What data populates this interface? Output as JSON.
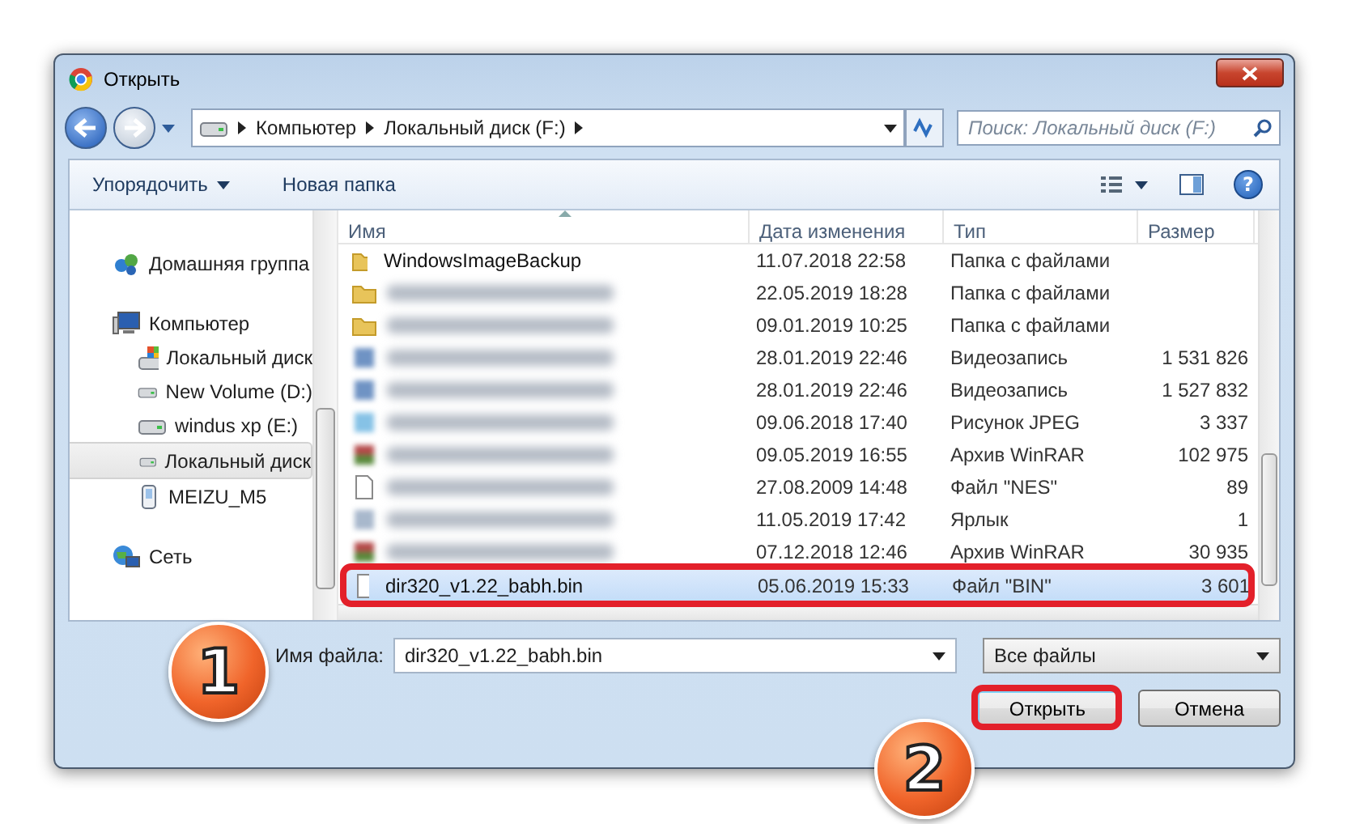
{
  "window": {
    "title": "Открыть"
  },
  "address": {
    "crumbs": [
      "Компьютер",
      "Локальный диск (F:)"
    ]
  },
  "search": {
    "placeholder": "Поиск: Локальный диск (F:)"
  },
  "toolbar": {
    "buttons": [
      "Упорядочить",
      "Новая папка"
    ],
    "help": "?"
  },
  "sidebar": {
    "items": [
      {
        "label": "Домашняя группа",
        "kind": "homegroup",
        "selected": false
      },
      {
        "label": "Компьютер",
        "kind": "computer",
        "selected": false,
        "children": [
          {
            "label": "Локальный диск",
            "kind": "system-drive",
            "selected": false
          },
          {
            "label": "New Volume (D:)",
            "kind": "drive",
            "selected": false
          },
          {
            "label": "windus xp (E:)",
            "kind": "drive",
            "selected": false
          },
          {
            "label": "Локальный диск",
            "kind": "drive",
            "selected": true
          },
          {
            "label": "MEIZU_M5",
            "kind": "phone",
            "selected": false
          }
        ]
      },
      {
        "label": "Сеть",
        "kind": "network",
        "selected": false
      }
    ]
  },
  "table": {
    "columns": [
      "Имя",
      "Дата изменения",
      "Тип",
      "Размер"
    ],
    "rows": [
      {
        "kind": "folder",
        "name": "WindowsImageBackup",
        "date": "11.07.2018 22:58",
        "type": "Папка с файлами",
        "selected": false,
        "highlighted": false
      },
      {
        "kind": "folder",
        "blurred": true,
        "date": "22.05.2019 18:28",
        "type": "Папка с файлами",
        "selected": false,
        "highlighted": false
      },
      {
        "kind": "folder",
        "blurred": true,
        "date": "09.01.2019 10:25",
        "type": "Папка с файлами",
        "selected": false,
        "highlighted": false
      },
      {
        "kind": "video",
        "blurred": true,
        "date": "28.01.2019 22:46",
        "type": "Видеозапись",
        "size": "1 531 826",
        "selected": false,
        "highlighted": false
      },
      {
        "kind": "video",
        "blurred": true,
        "date": "28.01.2019 22:46",
        "type": "Видеозапись",
        "size": "1 527 832",
        "selected": false,
        "highlighted": false
      },
      {
        "kind": "image",
        "blurred": true,
        "date": "09.06.2018 17:40",
        "type": "Рисунок JPEG",
        "size": "3 337",
        "selected": false,
        "highlighted": false
      },
      {
        "kind": "archive",
        "blurred": true,
        "date": "09.05.2019 16:55",
        "type": "Архив WinRAR",
        "size": "102 975",
        "selected": false,
        "highlighted": false
      },
      {
        "kind": "file",
        "blurred": true,
        "date": "27.08.2009 14:48",
        "type": "Файл \"NES\"",
        "size": "89",
        "selected": false,
        "highlighted": false
      },
      {
        "kind": "shortcut",
        "blurred": true,
        "date": "11.05.2019 17:42",
        "type": "Ярлык",
        "size": "1",
        "selected": false,
        "highlighted": false
      },
      {
        "kind": "archive",
        "blurred": true,
        "date": "07.12.2018 12:46",
        "type": "Архив WinRAR",
        "size": "30 935",
        "selected": false,
        "highlighted": false
      },
      {
        "kind": "file",
        "name": "dir320_v1.22_babh.bin",
        "date": "05.06.2019 15:33",
        "type": "Файл \"BIN\"",
        "size": "3 601",
        "selected": true,
        "highlighted": true
      }
    ]
  },
  "footer": {
    "filename_label": "Имя файла:",
    "filename": "dir320_v1.22_babh.bin",
    "filter": "Все файлы",
    "buttons": [
      {
        "label": "Открыть",
        "default": true,
        "highlighted": true
      },
      {
        "label": "Отмена",
        "default": false,
        "highlighted": false
      }
    ]
  },
  "markers": [
    "1",
    "2"
  ]
}
